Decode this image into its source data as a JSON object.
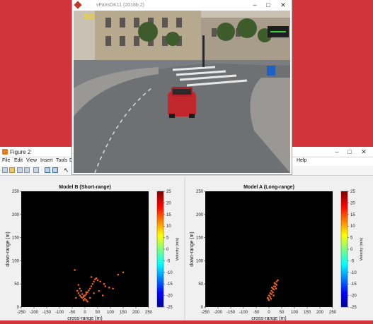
{
  "game_window": {
    "title": "vFansDK11 (2018b.2)",
    "speed": "60"
  },
  "figure_window": {
    "title": "Figure 2",
    "menu": [
      "File",
      "Edit",
      "View",
      "Insert",
      "Tools",
      "De",
      "Help"
    ],
    "toolbar_icons": [
      "new-figure-icon",
      "open-file-icon",
      "save-icon",
      "print-icon",
      "zoom-icon",
      "pan-icon",
      "data-cursor-icon",
      "pointer-icon"
    ]
  },
  "colors": {
    "background": "#d1343a",
    "plot_background": "#000000",
    "point_color": "#e8601c",
    "window_bg": "#f0f0f0"
  },
  "chart_data": [
    {
      "type": "scatter",
      "title": "Model B (Short-range)",
      "xlabel": "cross-range (m)",
      "ylabel": "down-range (m)",
      "colorbar_label": "Velocity (m/s)",
      "xlim": [
        -250,
        250
      ],
      "ylim": [
        0,
        250
      ],
      "xticks": [
        "-250",
        "-200",
        "-150",
        "-100",
        "-50",
        "0",
        "50",
        "100",
        "150",
        "200",
        "250"
      ],
      "yticks": [
        "0",
        "50",
        "100",
        "150",
        "200",
        "250"
      ],
      "colorbar_ticks": [
        "25",
        "20",
        "15",
        "10",
        "5",
        "0",
        "-5",
        "-10",
        "-15",
        "-20",
        "-25"
      ],
      "colorbar_range": [
        -25,
        25
      ],
      "x": [
        -30,
        -25,
        -20,
        -15,
        -10,
        -5,
        0,
        5,
        10,
        15,
        20,
        25,
        30,
        35,
        -20,
        -15,
        -10,
        -5,
        0,
        5,
        10,
        -25,
        40,
        45,
        50,
        60,
        75,
        80,
        95,
        110,
        130,
        150,
        35,
        20,
        5,
        -5,
        25,
        55,
        70,
        -35,
        -40
      ],
      "y": [
        35,
        30,
        25,
        22,
        20,
        22,
        25,
        28,
        32,
        36,
        40,
        45,
        50,
        55,
        40,
        35,
        28,
        24,
        18,
        15,
        12,
        48,
        60,
        62,
        58,
        55,
        50,
        45,
        42,
        40,
        70,
        75,
        30,
        20,
        32,
        15,
        65,
        35,
        25,
        20,
        80
      ],
      "values": [
        -1,
        0,
        1,
        0,
        -1,
        0,
        1,
        0,
        -1,
        0,
        1,
        0,
        -1,
        0,
        0,
        1,
        0,
        -1,
        0,
        1,
        0,
        0,
        1,
        0,
        -1,
        0,
        1,
        0,
        -1,
        0,
        1,
        0,
        -1,
        0,
        1,
        0,
        0,
        1,
        0,
        -1,
        0
      ]
    },
    {
      "type": "scatter",
      "title": "Model A (Long-range)",
      "xlabel": "cross-range (m)",
      "ylabel": "down-range (m)",
      "colorbar_label": "Velocity (m/s)",
      "xlim": [
        -250,
        250
      ],
      "ylim": [
        0,
        250
      ],
      "xticks": [
        "-250",
        "-200",
        "-150",
        "-100",
        "-50",
        "0",
        "50",
        "100",
        "150",
        "200",
        "250"
      ],
      "yticks": [
        "0",
        "50",
        "100",
        "150",
        "200",
        "250"
      ],
      "colorbar_ticks": [
        "25",
        "20",
        "15",
        "10",
        "5",
        "0",
        "-5",
        "-10",
        "-15",
        "-20",
        "-25"
      ],
      "colorbar_range": [
        -25,
        25
      ],
      "x": [
        -5,
        0,
        5,
        10,
        15,
        20,
        25,
        30,
        35,
        0,
        5,
        10,
        15,
        20,
        25,
        30,
        -3,
        8,
        18,
        28,
        12,
        22
      ],
      "y": [
        20,
        25,
        30,
        35,
        40,
        45,
        50,
        55,
        58,
        15,
        22,
        28,
        32,
        38,
        44,
        48,
        18,
        18,
        25,
        40,
        42,
        52
      ],
      "values": [
        0,
        1,
        0,
        -1,
        0,
        1,
        0,
        -1,
        0,
        0,
        1,
        0,
        -1,
        0,
        1,
        0,
        -1,
        0,
        1,
        0,
        0,
        1
      ]
    }
  ]
}
